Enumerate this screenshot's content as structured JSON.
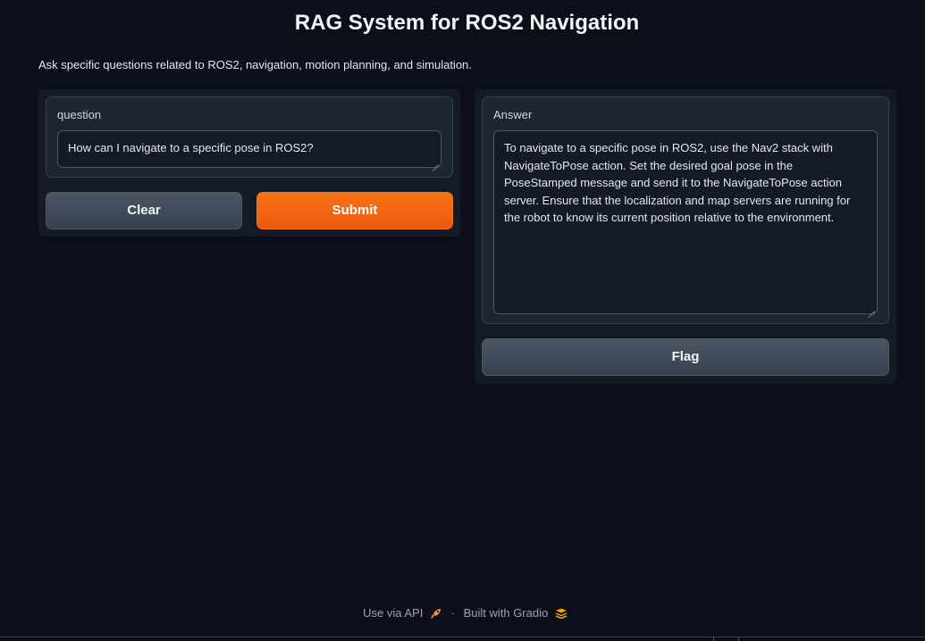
{
  "page": {
    "title": "RAG System for ROS2 Navigation",
    "description": "Ask specific questions related to ROS2, navigation, motion planning, and simulation."
  },
  "input": {
    "label": "question",
    "value": "How can I navigate to a specific pose in ROS2?"
  },
  "buttons": {
    "clear": "Clear",
    "submit": "Submit",
    "flag": "Flag"
  },
  "output": {
    "label": "Answer",
    "value": "To navigate to a specific pose in ROS2, use the Nav2 stack with NavigateToPose action. Set the desired goal pose in the PoseStamped message and send it to the NavigateToPose action server. Ensure that the localization and map servers are running for the robot to know its current position relative to the environment."
  },
  "footer": {
    "api_link": "Use via API",
    "separator": "·",
    "built_with": "Built with Gradio"
  },
  "icons": {
    "api": "rocket-icon",
    "gradio": "gradio-logo-icon"
  },
  "colors": {
    "background": "#0b0f19",
    "primary": "#f97316",
    "secondary": "#4b5563"
  }
}
